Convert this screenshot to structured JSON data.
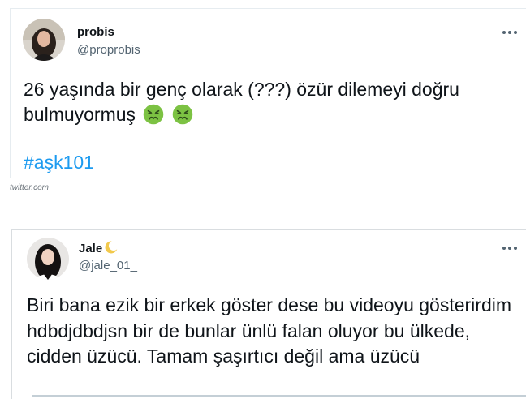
{
  "tweets": [
    {
      "author": {
        "display_name": "probis",
        "handle": "@proprobis",
        "avatar": "woman-portrait-avatar"
      },
      "text": "26 yaşında bir genç olarak (???) özür dilemeyi doğru bulmuyormuş",
      "emojis": [
        "nauseated-face-emoji",
        "nauseated-face-emoji"
      ],
      "hashtag": "#aşk101",
      "more_icon": "ellipsis-icon"
    },
    {
      "author": {
        "display_name": "Jale",
        "handle": "@jale_01_",
        "avatar": "woman-portrait-avatar",
        "badge": "moon-badge-icon"
      },
      "text": "Biri bana ezik bir erkek göster dese bu videoyu gösterirdim hdbdjdbdjsn bir de bunlar ünlü falan oluyor bu ülkede, cidden üzücü. Tamam şaşırtıcı değil ama üzücü",
      "more_icon": "ellipsis-icon"
    }
  ],
  "watermark": "twitter.com",
  "colors": {
    "text": "#0f1419",
    "secondary": "#536471",
    "link": "#1d9bf0",
    "emoji_green": "#7cc243"
  }
}
